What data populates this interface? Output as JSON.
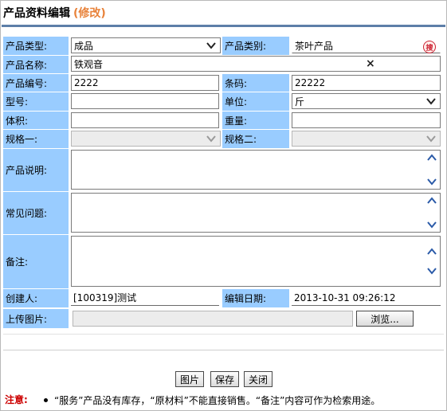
{
  "page": {
    "title": "产品资料编辑",
    "mode": "(修改)"
  },
  "form": {
    "product_type": {
      "label": "产品类型:",
      "value": "成品"
    },
    "product_category": {
      "label": "产品类别:",
      "value": "茶叶产品",
      "search_badge": "搜"
    },
    "product_name": {
      "label": "产品名称:",
      "value": "铁观音",
      "clear": "×"
    },
    "product_code": {
      "label": "产品编号:",
      "value": "2222"
    },
    "barcode": {
      "label": "条码:",
      "value": "22222"
    },
    "model": {
      "label": "型号:",
      "value": ""
    },
    "unit": {
      "label": "单位:",
      "value": "斤"
    },
    "volume": {
      "label": "体积:",
      "value": ""
    },
    "weight": {
      "label": "重量:",
      "value": ""
    },
    "spec1": {
      "label": "规格一:",
      "value": ""
    },
    "spec2": {
      "label": "规格二:",
      "value": ""
    },
    "description": {
      "label": "产品说明:",
      "value": ""
    },
    "faq": {
      "label": "常见问题:",
      "value": ""
    },
    "remarks": {
      "label": "备注:",
      "value": ""
    },
    "creator": {
      "label": "创建人:",
      "value": "[100319]测试"
    },
    "edit_date": {
      "label": "编辑日期:",
      "value": "2013-10-31 09:26:12"
    },
    "upload": {
      "label": "上传图片:",
      "value": "",
      "browse": "浏览..."
    }
  },
  "buttons": {
    "image": "图片",
    "save": "保存",
    "close": "关闭"
  },
  "note": {
    "label": "注意:",
    "text": "“服务”产品没有库存，“原材料”不能直接销售。“备注”内容可作为检索用途。"
  },
  "icons": {
    "dropdown": "chevron-down-icon",
    "scroll_up": "chevron-up-icon",
    "scroll_down": "chevron-down-icon",
    "clear": "close-icon",
    "search": "search-icon"
  },
  "colors": {
    "label_bg": "#99ccff",
    "title_mode": "#e8823a",
    "title_rule": "#5d7fa8",
    "note": "#cc0000"
  }
}
